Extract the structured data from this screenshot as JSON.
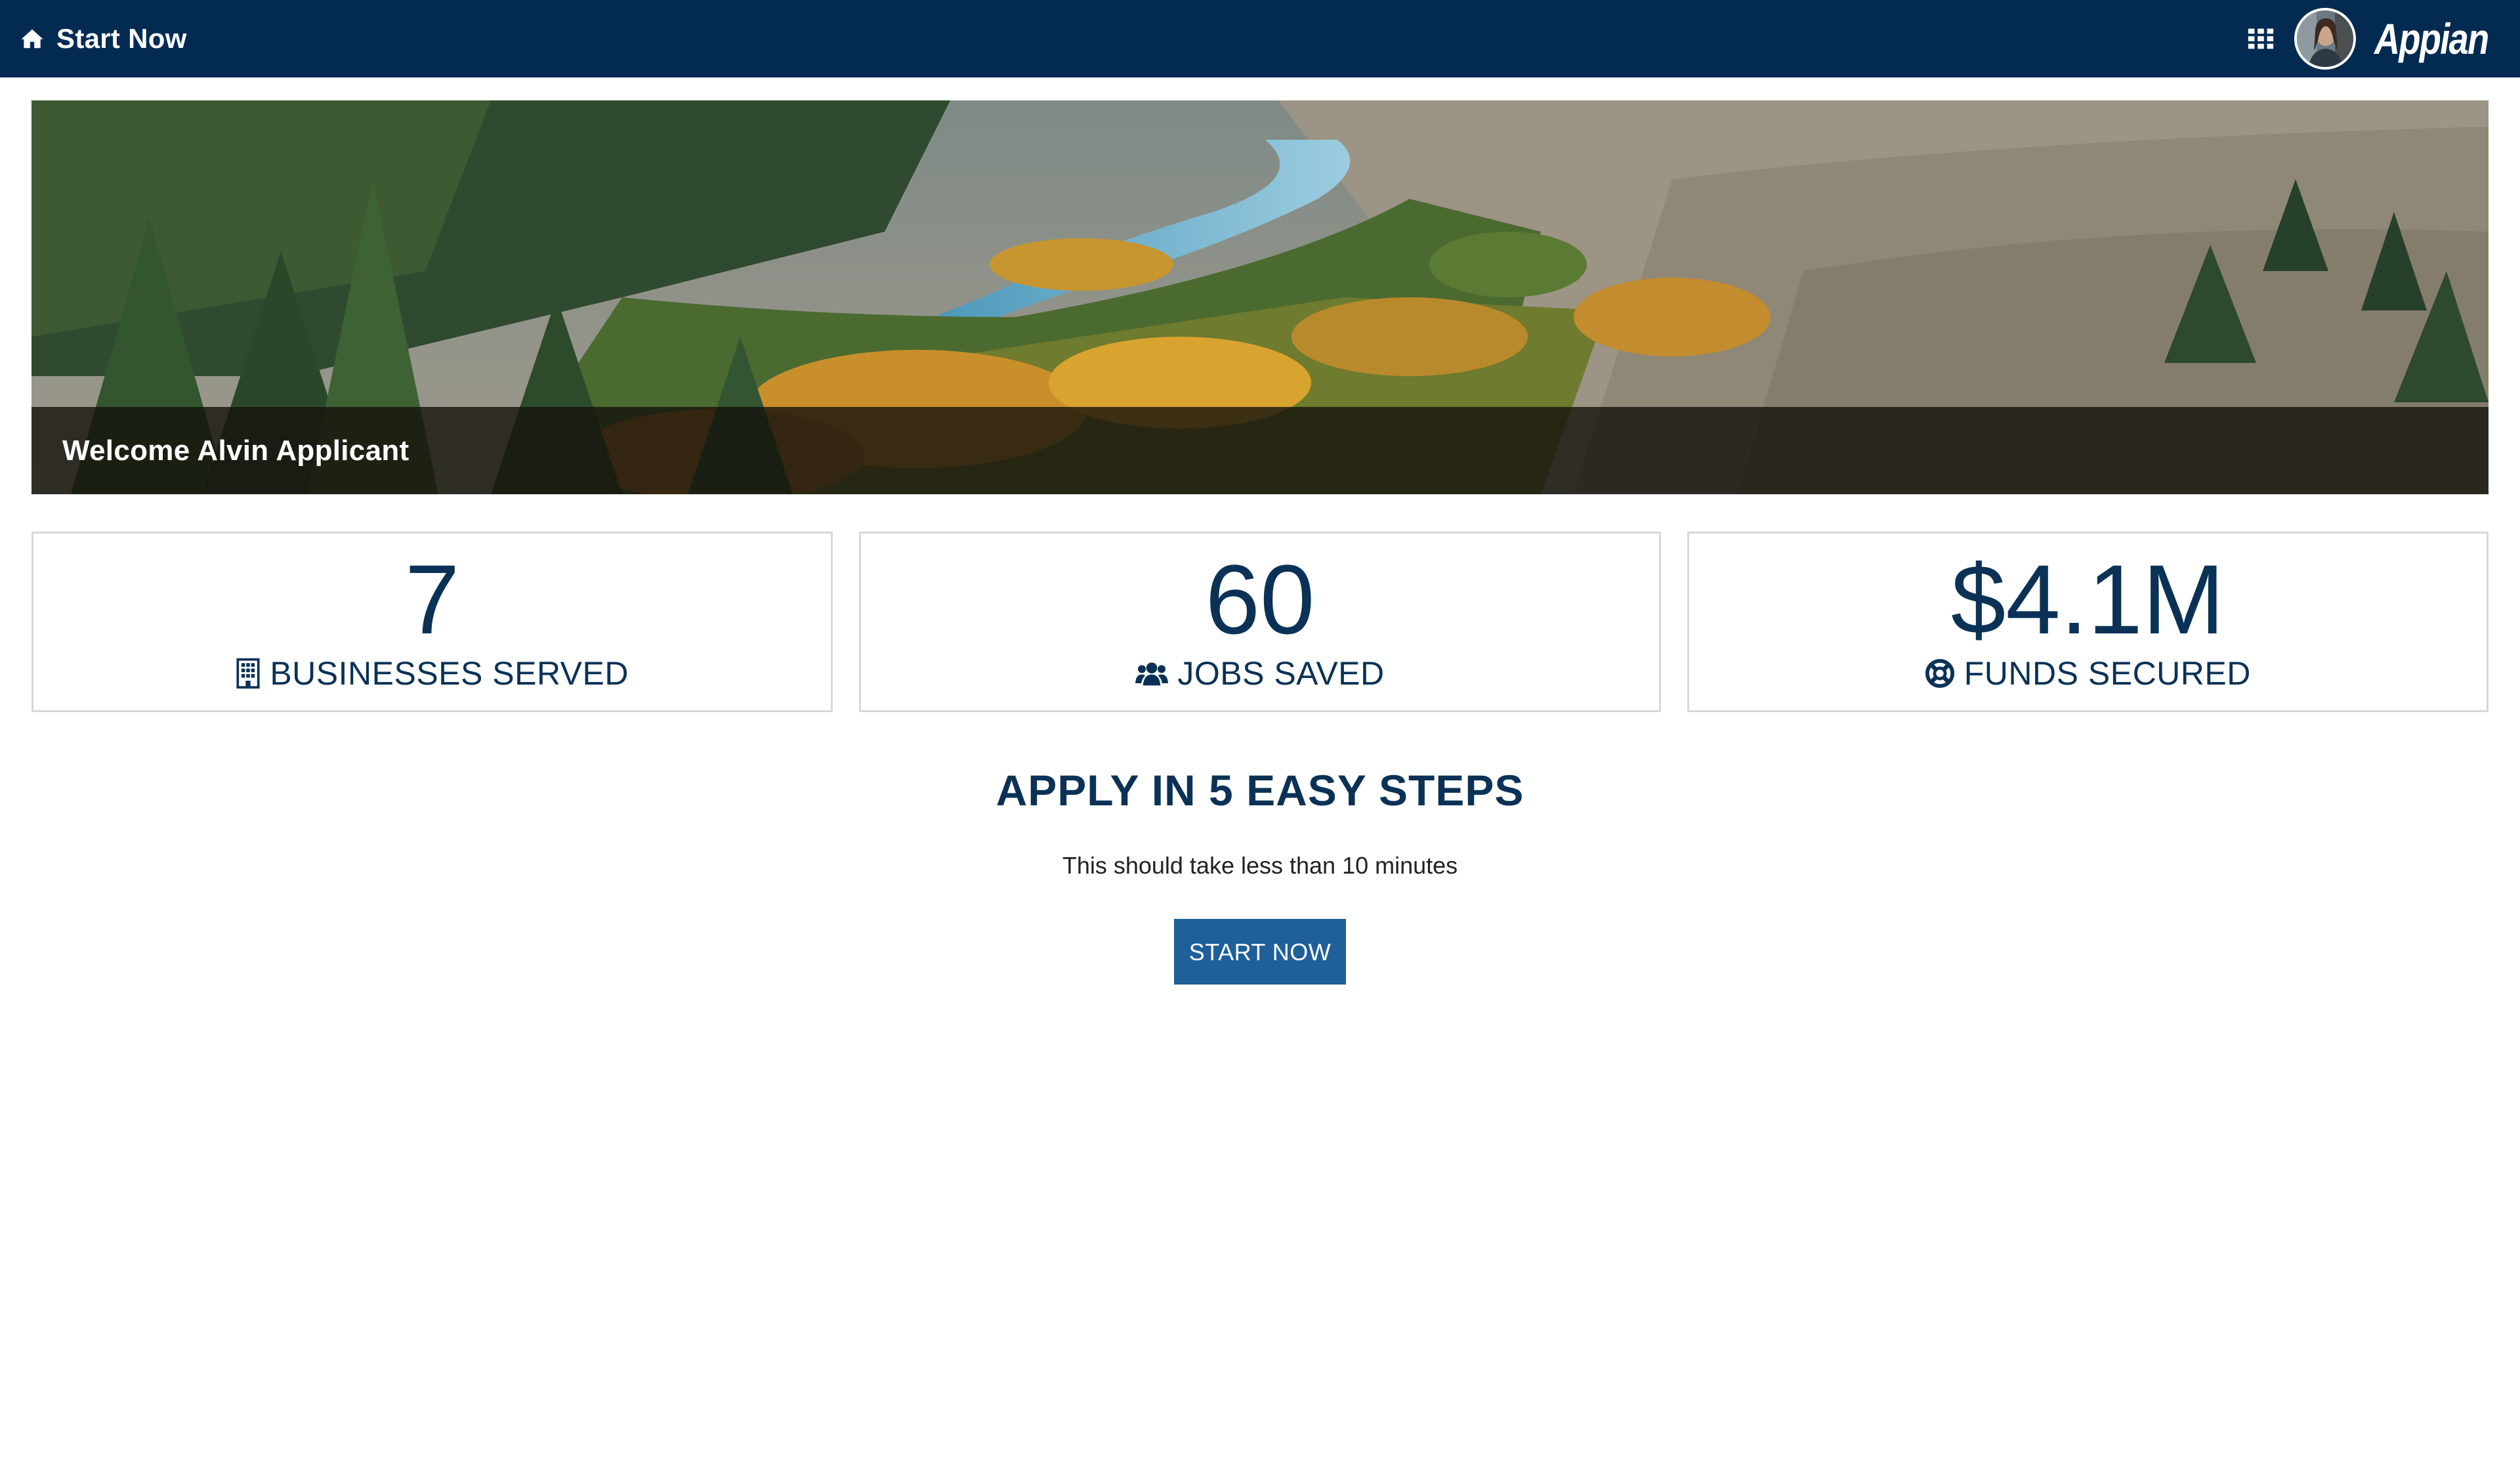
{
  "header": {
    "home_label": "Start Now",
    "logo_text": "Appian",
    "home_icon": "home-icon",
    "apps_icon": "grid-icon"
  },
  "hero": {
    "welcome_text": "Welcome Alvin Applicant"
  },
  "stats": [
    {
      "value": "7",
      "label": "BUSINESSES SERVED",
      "icon": "building-icon"
    },
    {
      "value": "60",
      "label": "JOBS SAVED",
      "icon": "users-icon"
    },
    {
      "value": "$4.1M",
      "label": "FUNDS SECURED",
      "icon": "life-ring-icon"
    }
  ],
  "apply": {
    "title": "APPLY IN 5 EASY STEPS",
    "subtitle": "This should take less than 10 minutes",
    "button_label": "START NOW"
  },
  "colors": {
    "header_bg": "#032b52",
    "primary_text": "#0b3256",
    "button_bg": "#1f5f9a"
  }
}
